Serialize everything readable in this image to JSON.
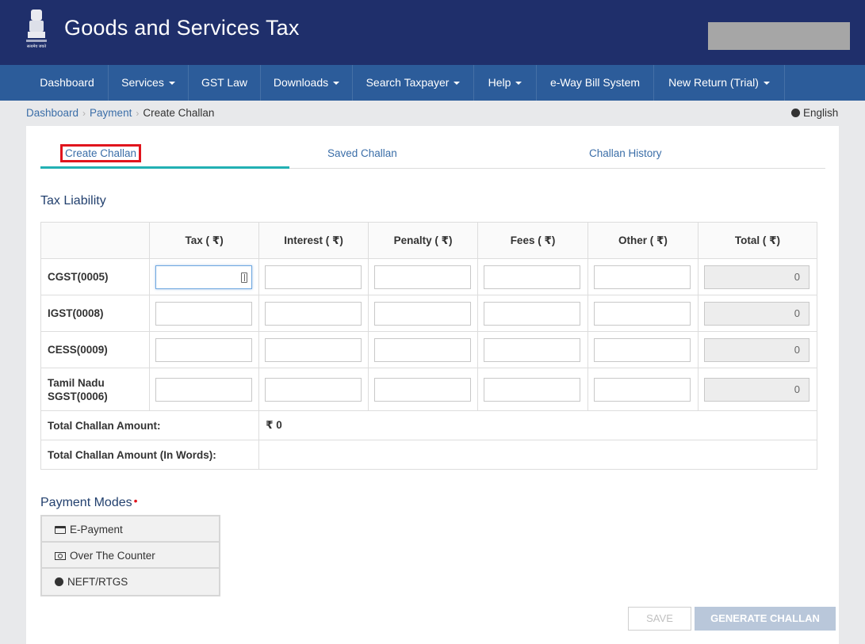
{
  "header": {
    "title": "Goods and Services Tax",
    "emblem_caption": "सत्यमेव जयते"
  },
  "nav": [
    {
      "label": "Dashboard",
      "dropdown": false
    },
    {
      "label": "Services",
      "dropdown": true
    },
    {
      "label": "GST Law",
      "dropdown": false
    },
    {
      "label": "Downloads",
      "dropdown": true
    },
    {
      "label": "Search Taxpayer",
      "dropdown": true
    },
    {
      "label": "Help",
      "dropdown": true
    },
    {
      "label": "e-Way Bill System",
      "dropdown": false
    },
    {
      "label": "New Return (Trial)",
      "dropdown": true
    }
  ],
  "breadcrumb": [
    "Dashboard",
    "Payment",
    "Create Challan"
  ],
  "language": "English",
  "tabs": [
    "Create Challan",
    "Saved Challan",
    "Challan History"
  ],
  "tax_liability": {
    "title": "Tax Liability",
    "columns": [
      "Tax ( ₹)",
      "Interest ( ₹)",
      "Penalty ( ₹)",
      "Fees ( ₹)",
      "Other ( ₹)",
      "Total ( ₹)"
    ],
    "rows": [
      {
        "label": "CGST(0005)",
        "total": "0"
      },
      {
        "label": "IGST(0008)",
        "total": "0"
      },
      {
        "label": "CESS(0009)",
        "total": "0"
      },
      {
        "label": "Tamil Nadu SGST(0006)",
        "total": "0"
      }
    ],
    "total_amount_label": "Total Challan Amount:",
    "total_amount_value": "₹ 0",
    "total_words_label": "Total Challan Amount (In Words):",
    "total_words_value": ""
  },
  "payment_modes": {
    "title": "Payment Modes",
    "required_mark": "•",
    "options": [
      {
        "label": "E-Payment",
        "icon": "credit-card-icon"
      },
      {
        "label": "Over The Counter",
        "icon": "cash-icon"
      },
      {
        "label": "NEFT/RTGS",
        "icon": "globe-icon"
      }
    ]
  },
  "buttons": {
    "save": "SAVE",
    "generate": "GENERATE CHALLAN"
  },
  "colors": {
    "header_bg": "#1f2f6b",
    "nav_bg": "#2c5c9a",
    "tab_underline": "#22b0b3",
    "highlight_box": "#e0151d",
    "link": "#3b6ea8"
  }
}
